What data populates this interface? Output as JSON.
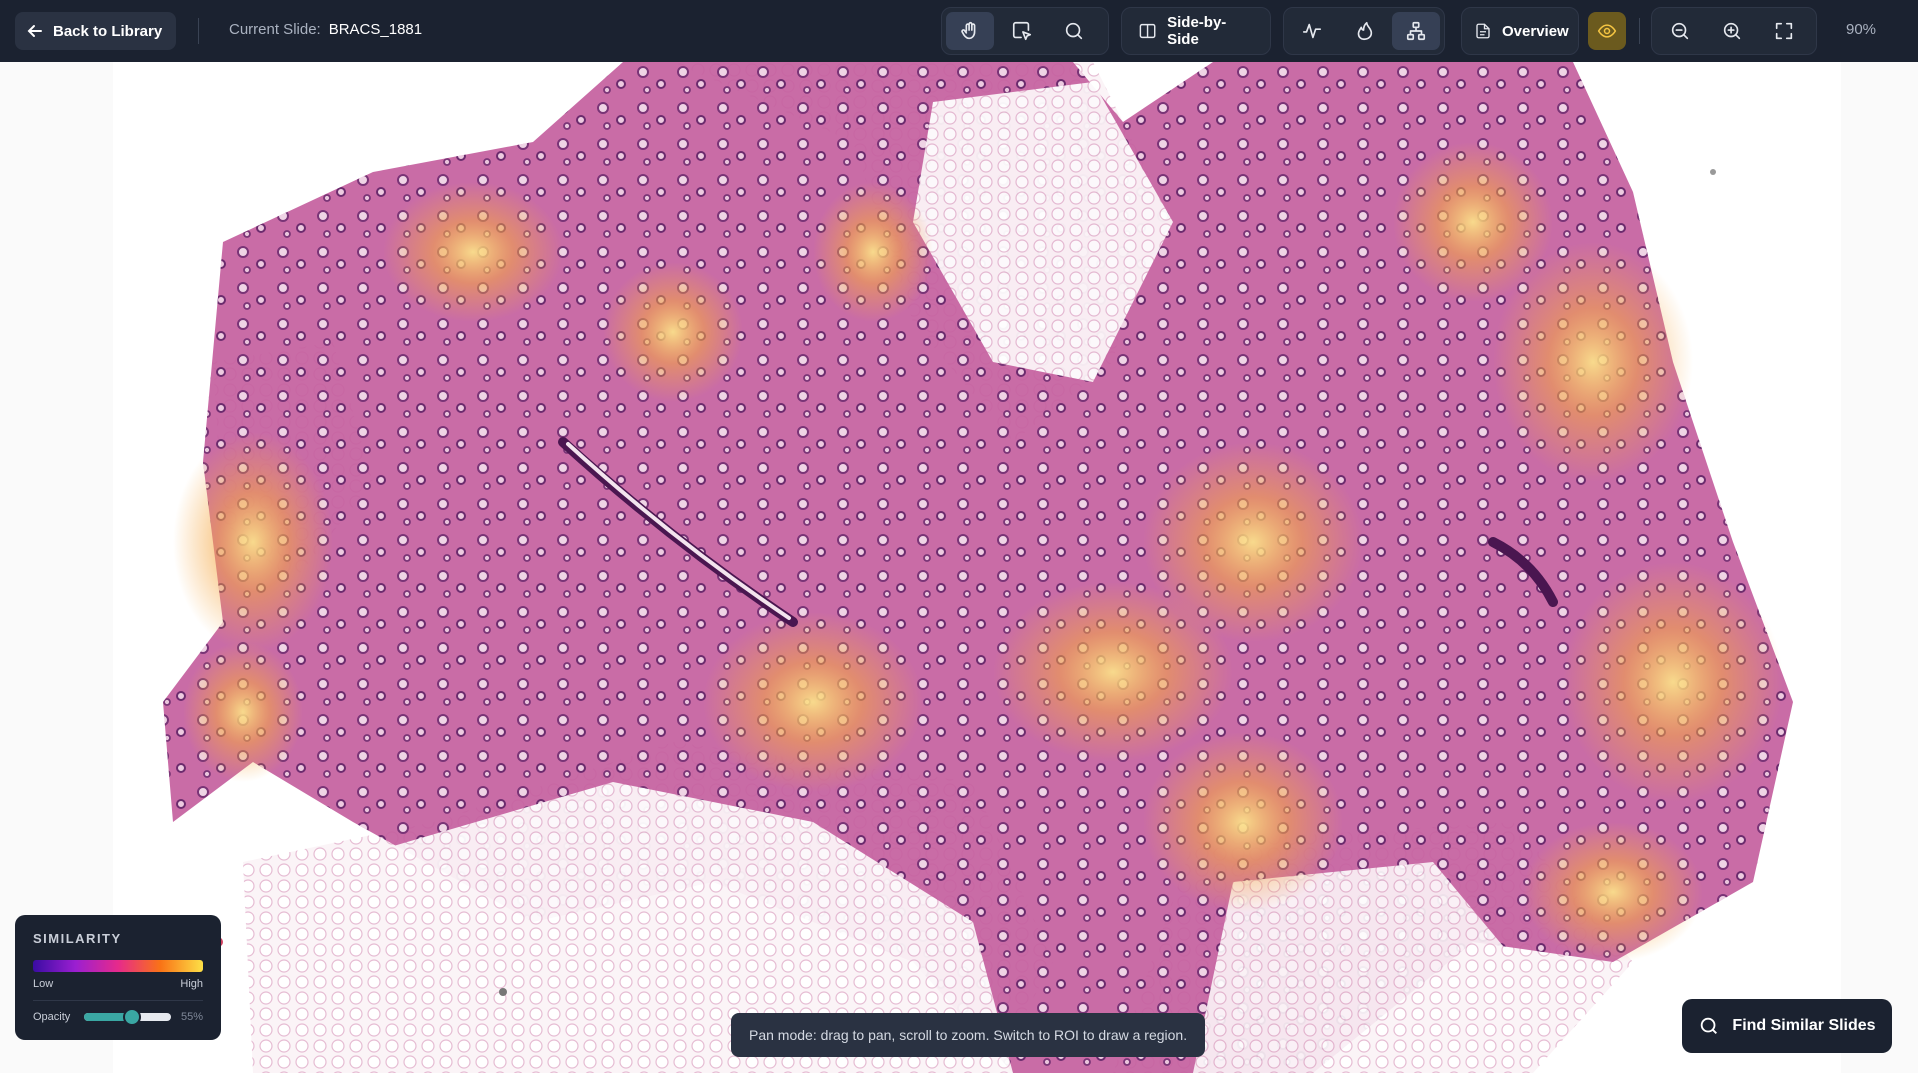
{
  "header": {
    "back_label": "Back to Library",
    "current_slide_label": "Current Slide:",
    "current_slide_value": "BRACS_1881",
    "side_by_side_label": "Side-by-Side",
    "overview_label": "Overview",
    "zoom_level": "90%"
  },
  "tools": {
    "pan": "hand-icon",
    "roi": "roi-select-icon",
    "search": "search-icon",
    "split": "split-view-icon",
    "activity": "activity-icon",
    "heatmap": "flame-icon",
    "graph": "graph-icon",
    "overview": "document-icon",
    "visibility": "eye-icon",
    "zoom_out": "zoom-out-icon",
    "zoom_in": "zoom-in-icon",
    "fullscreen": "fullscreen-icon"
  },
  "legend": {
    "title": "SIMILARITY",
    "low": "Low",
    "high": "High",
    "opacity_label": "Opacity",
    "opacity_value": "55%",
    "opacity_fraction": 0.55
  },
  "toast": {
    "message": "Pan mode: drag to pan, scroll to zoom. Switch to ROI to draw a region."
  },
  "actions": {
    "find_similar_label": "Find Similar Slides"
  },
  "colors": {
    "topbar": "#1b2230",
    "tissue": "#c9609f",
    "heat": "#f5b041",
    "accent": "#3aa7a3"
  }
}
